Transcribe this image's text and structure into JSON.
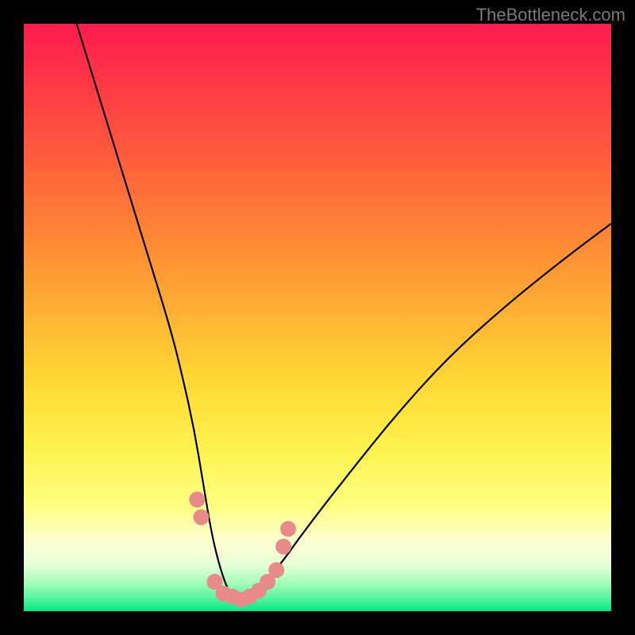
{
  "watermark": "TheBottleneck.com",
  "chart_data": {
    "type": "line",
    "title": "",
    "xlabel": "",
    "ylabel": "",
    "xlim": [
      0,
      100
    ],
    "ylim": [
      0,
      100
    ],
    "grid": false,
    "series": [
      {
        "name": "bottleneck-curve",
        "x": [
          9,
          13,
          17,
          21,
          25,
          27,
          29,
          30.5,
          32,
          33.5,
          35,
          37,
          39,
          43,
          48,
          55,
          63,
          72,
          82,
          92,
          100
        ],
        "y": [
          100,
          87,
          74,
          61,
          48,
          40,
          31,
          22,
          13,
          7,
          3,
          2,
          3,
          7,
          14,
          23,
          33,
          43,
          52,
          60,
          66
        ]
      }
    ],
    "highlight_points": {
      "name": "critical-zone-markers",
      "color": "#e88a8a",
      "x": [
        29.5,
        30.2,
        32.5,
        34,
        35.5,
        37,
        38.5,
        40,
        41.5,
        43,
        44.2,
        45
      ],
      "y": [
        19,
        16,
        5,
        3,
        2.5,
        2,
        2.5,
        3.5,
        5,
        7,
        11,
        14
      ]
    },
    "background_gradient": {
      "stops": [
        {
          "offset": 0.0,
          "color": "#ff1a4f"
        },
        {
          "offset": 0.22,
          "color": "#ff5a3c"
        },
        {
          "offset": 0.42,
          "color": "#ff9933"
        },
        {
          "offset": 0.6,
          "color": "#ffd633"
        },
        {
          "offset": 0.72,
          "color": "#fff24d"
        },
        {
          "offset": 0.82,
          "color": "#ffff80"
        },
        {
          "offset": 0.88,
          "color": "#ffffd0"
        },
        {
          "offset": 0.92,
          "color": "#e8ffd8"
        },
        {
          "offset": 0.95,
          "color": "#a8ffb8"
        },
        {
          "offset": 0.975,
          "color": "#60f5a0"
        },
        {
          "offset": 1.0,
          "color": "#00e884"
        }
      ]
    }
  }
}
